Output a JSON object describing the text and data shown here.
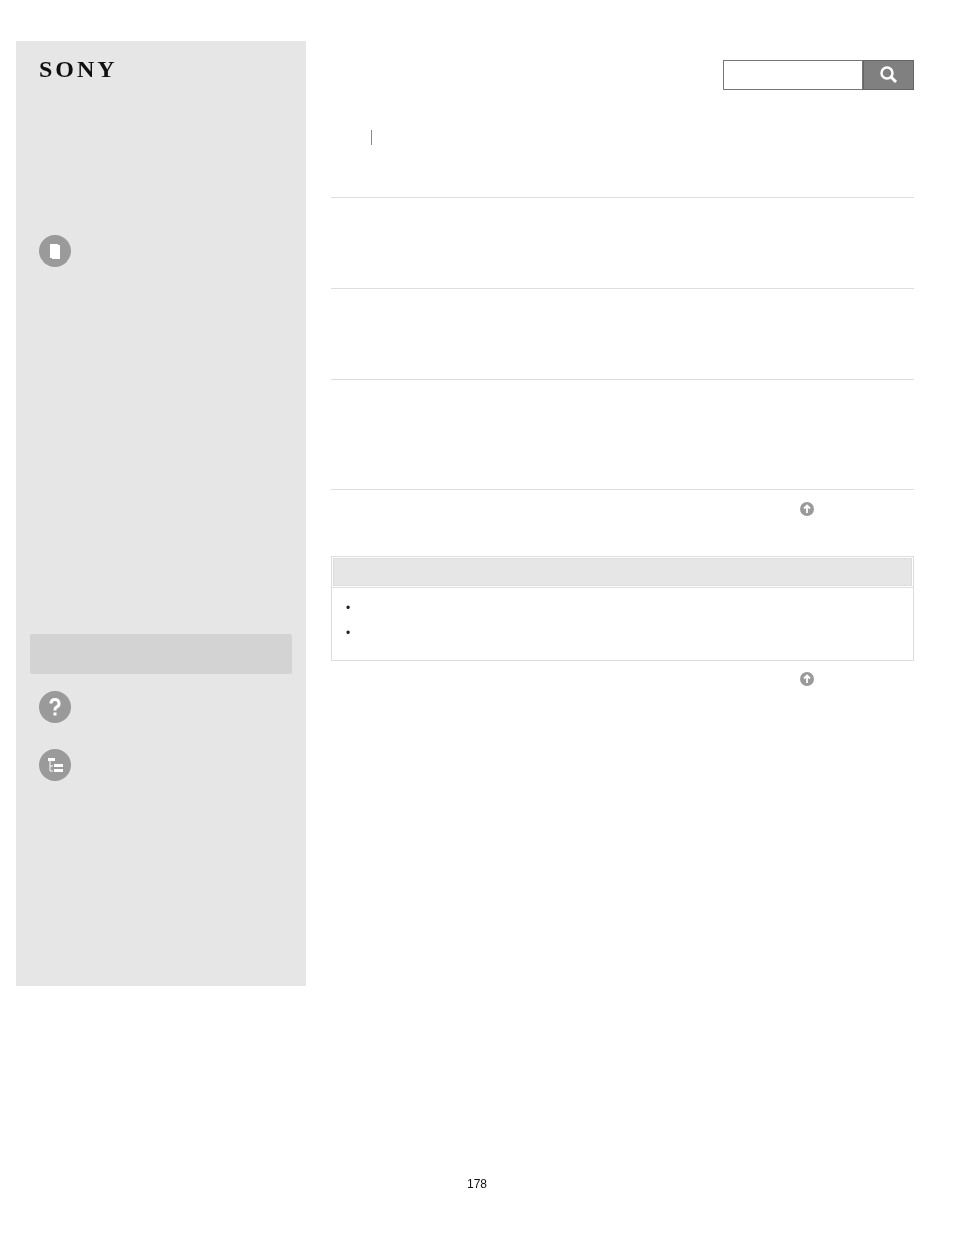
{
  "sidebar": {
    "logo": "SONY"
  },
  "note_box": {
    "bullets": [
      "•",
      "•"
    ]
  },
  "page_number": "178"
}
